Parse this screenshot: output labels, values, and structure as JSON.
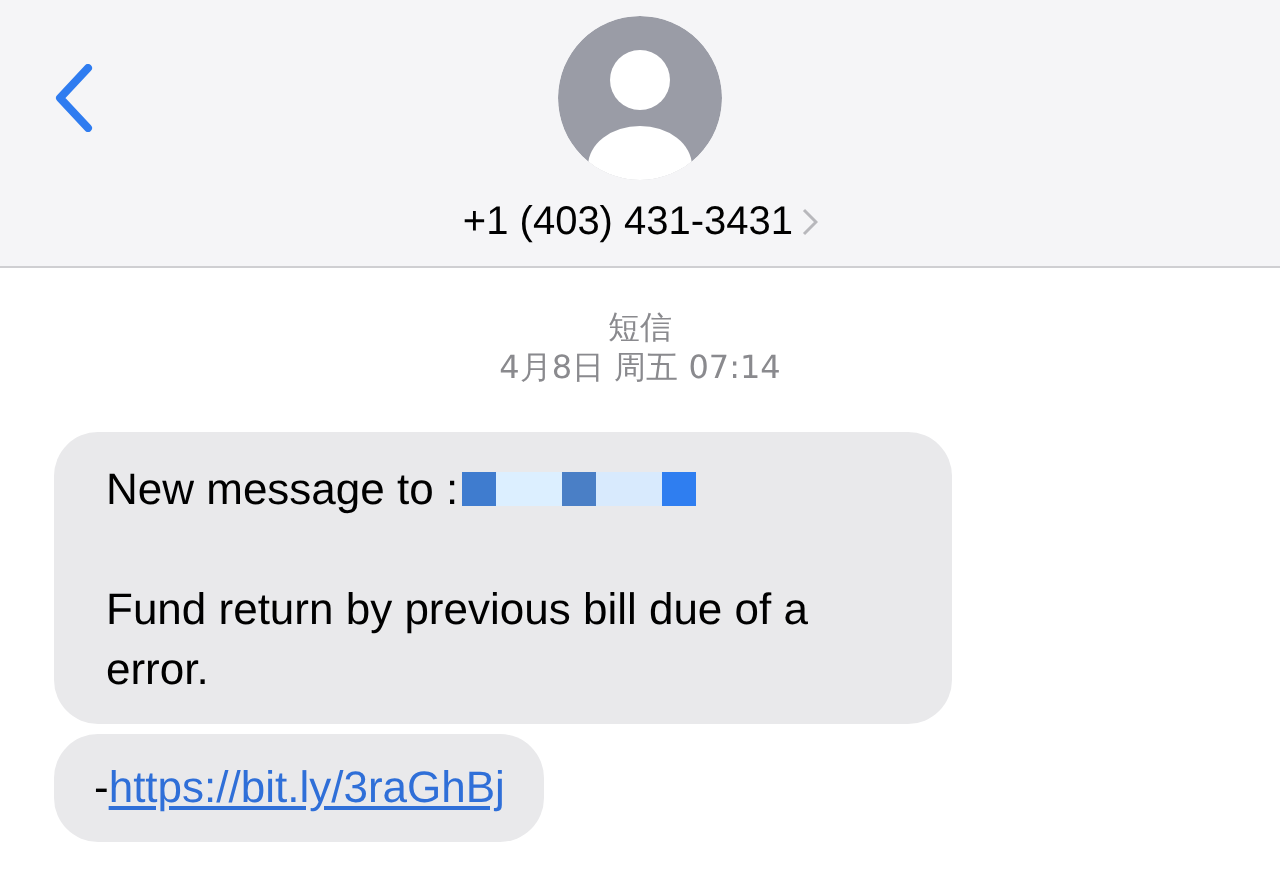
{
  "header": {
    "contact": "+1 (403) 431-3431"
  },
  "conversation": {
    "service": "短信",
    "timestamp": "4月8日 周五 07:14",
    "messages": [
      {
        "kind": "text",
        "lines": [
          "New message to :",
          "Fund return by previous bill due of a error."
        ],
        "redacted": true
      },
      {
        "kind": "link",
        "prefix": "-",
        "link": "https://bit.ly/3raGhBj"
      }
    ]
  }
}
